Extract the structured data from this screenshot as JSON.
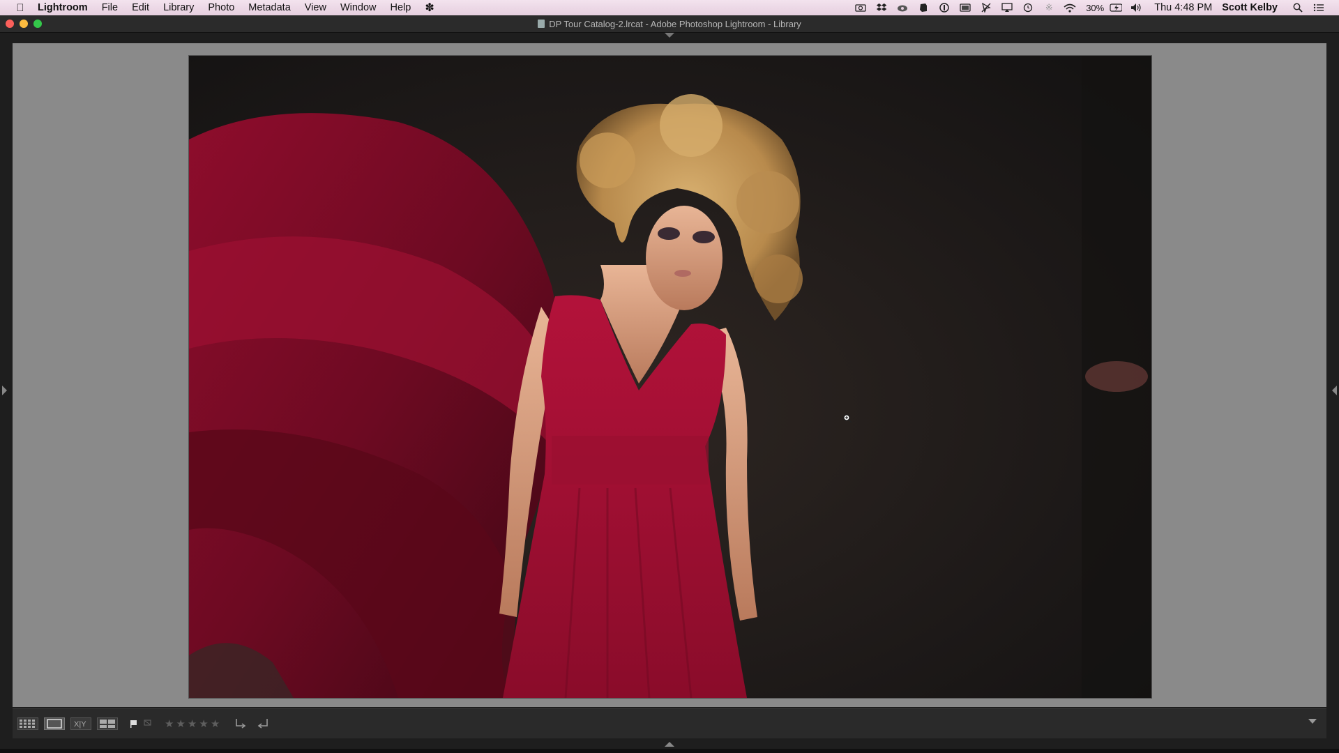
{
  "menubar": {
    "apple_icon": "apple-logo-icon",
    "app_name": "Lightroom",
    "items": [
      "File",
      "Edit",
      "Library",
      "Photo",
      "Metadata",
      "View",
      "Window",
      "Help"
    ],
    "battery_percent": "30%",
    "clock": "Thu 4:48 PM",
    "user": "Scott Kelby",
    "status_icons": [
      "camera-icon",
      "dropbox-icon",
      "creative-cloud-icon",
      "evernote-icon",
      "1password-icon",
      "display-icon",
      "cursor-icon",
      "airplay-icon",
      "time-machine-icon",
      "bluetooth-icon",
      "wifi-icon",
      "battery-icon",
      "volume-icon"
    ]
  },
  "window": {
    "title": "DP Tour Catalog-2.lrcat - Adobe Photoshop Lightroom - Library"
  },
  "toolbar": {
    "view_modes": [
      "grid-view-icon",
      "loupe-view-icon",
      "compare-view-icon",
      "survey-view-icon"
    ],
    "rating_stars": 5,
    "rating_value": 0,
    "rotate_left_icon": "rotate-left-icon",
    "rotate_right_icon": "rotate-right-icon"
  },
  "colors": {
    "loupe_background": "#8a8a8a",
    "dress_red": "#b3123a",
    "hair_blonde": "#c9a060"
  }
}
